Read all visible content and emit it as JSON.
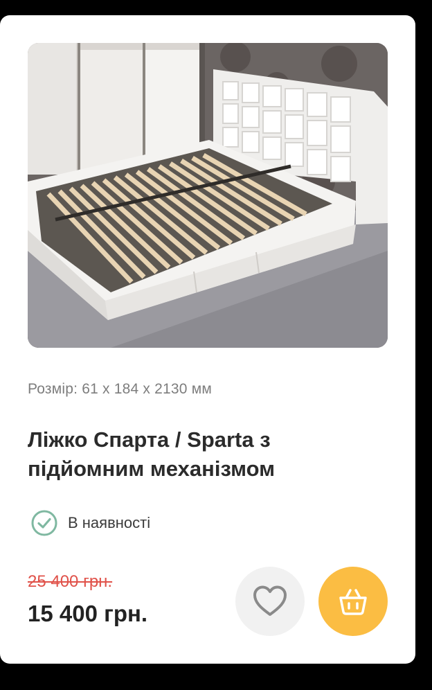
{
  "product": {
    "size_label": "Розмір: 61 x 184 x 2130 мм",
    "title": "Ліжко Спарта / Sparta з підйомним механізмом",
    "stock_status": "В наявності",
    "old_price": "25 400 грн.",
    "price": "15 400 грн.",
    "image": "white-upholstered-bed-photo"
  },
  "icons": {
    "stock": "check-circle-icon",
    "favorite": "heart-icon",
    "cart": "basket-icon"
  },
  "colors": {
    "old_price": "#e0524a",
    "check": "#7fb8a1",
    "cart_button": "#fbbd43",
    "fav_button": "#f1f1f1"
  }
}
